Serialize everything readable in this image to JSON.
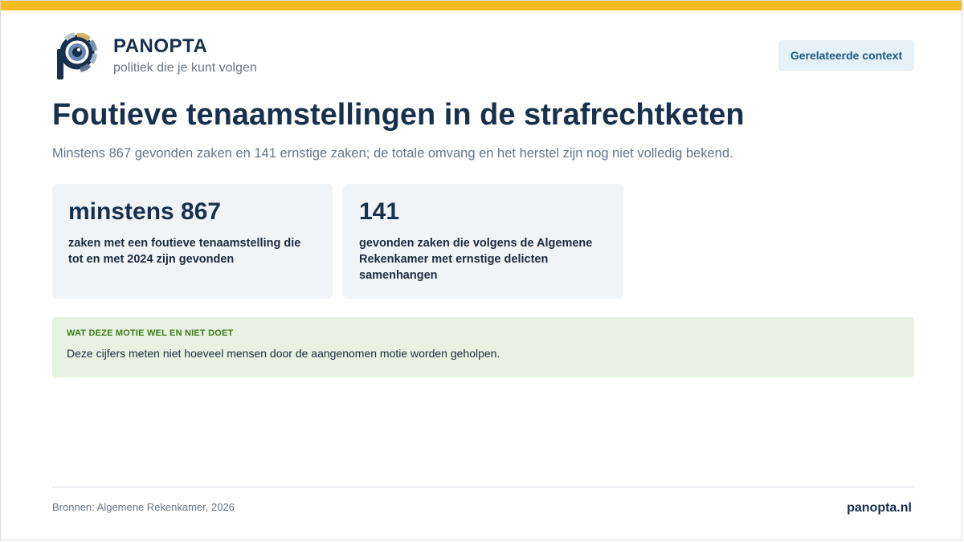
{
  "brand": {
    "name": "PANOPTA",
    "tagline": "politiek die je kunt volgen"
  },
  "header": {
    "context_button_label": "Gerelateerde context"
  },
  "title": "Foutieve tenaamstellingen in de strafrechtketen",
  "subtitle": "Minstens 867 gevonden zaken en 141 ernstige zaken; de totale omvang en het herstel zijn nog niet volledig bekend.",
  "stats": [
    {
      "value": "minstens 867",
      "description": "zaken met een foutieve tenaamstelling die tot en met 2024 zijn gevonden"
    },
    {
      "value": "141",
      "description": "gevonden zaken die volgens de Algemene Rekenkamer met ernstige delicten samenhangen"
    }
  ],
  "notice": {
    "label": "WAT DEZE MOTIE WEL EN NIET DOET",
    "text": "Deze cijfers meten niet hoeveel mensen door de aangenomen motie worden geholpen."
  },
  "footer": {
    "sources": "Bronnen: Algemene Rekenkamer, 2026",
    "site": "panopta.nl"
  },
  "colors": {
    "accent_bar": "#fbbb23",
    "navy": "#16304d",
    "notice_bg": "#e7f2e2",
    "notice_label": "#3f7a18",
    "card_bg": "#f1f4f7"
  },
  "icons": {
    "logo": "panopta-eye-logo"
  }
}
